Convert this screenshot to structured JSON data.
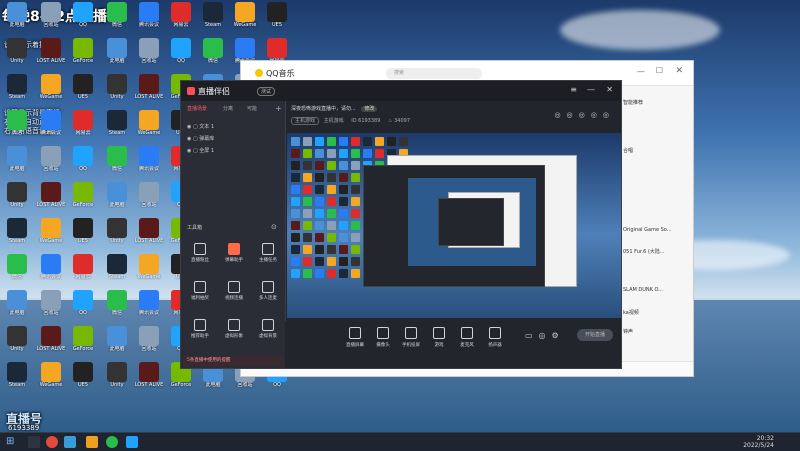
{
  "overlay": {
    "headline": "每晚8-12点直播",
    "left_lines": [
      "说明显示着播消息",
      "设置显示背景直播",
      "右上角自动直播",
      "右上角语音设置"
    ],
    "bottom_brand": "直播号",
    "bottom_id": "6193389"
  },
  "desktop_icons": [
    {
      "label": "此电脑",
      "color": "#4a90d9"
    },
    {
      "label": "回收站",
      "color": "#8aa0b8"
    },
    {
      "label": "QQ",
      "color": "#1fa3ff"
    },
    {
      "label": "微信",
      "color": "#2bbd4c"
    },
    {
      "label": "腾讯会议",
      "color": "#2a7cf5"
    },
    {
      "label": "网易云",
      "color": "#e02b2b"
    },
    {
      "label": "Steam",
      "color": "#1b2838"
    },
    {
      "label": "WeGame",
      "color": "#f5a623"
    },
    {
      "label": "UE5",
      "color": "#222"
    },
    {
      "label": "Unity",
      "color": "#333"
    },
    {
      "label": "LOST ALIVE",
      "color": "#5a1a1a"
    },
    {
      "label": "GeForce",
      "color": "#76b900"
    }
  ],
  "taskbar": {
    "time": "20:32",
    "date": "2022/5/24"
  },
  "qq_music": {
    "title": "QQ音乐",
    "search_placeholder": "搜索",
    "right_list": [
      "智能推荐",
      "合唱",
      "Original Game So...",
      "051 Fur.6 (大陆...",
      "SLAM DUNK O...",
      "ka视频",
      "钟声"
    ]
  },
  "live_tool": {
    "title": "直播伴侣",
    "badge": "测试",
    "tabs": [
      "直播场景",
      "分离",
      "可能"
    ],
    "scenes": [
      "文本 1",
      "弹幕库",
      "全屏 1"
    ],
    "tools_label": "工具箱",
    "tools": [
      {
        "label": "直播粉丝",
        "on": false
      },
      {
        "label": "弹幕助手",
        "on": true
      },
      {
        "label": "主播任务",
        "on": false
      },
      {
        "label": "福利抽奖",
        "on": false
      },
      {
        "label": "视频连播",
        "on": false
      },
      {
        "label": "多人连麦",
        "on": false
      },
      {
        "label": "推荐助手",
        "on": false
      },
      {
        "label": "虚拟形象",
        "on": false
      },
      {
        "label": "虚拟背景",
        "on": false
      }
    ],
    "banner": "5条直播中使用的提醒",
    "info_title": "深夜恐怖游戏直播中，请勿...",
    "info_badge": "修改",
    "info_id": "6193389",
    "info_views": "34097",
    "info_tag1": "主机游戏",
    "info_tag2": "主机游戏",
    "bottom_buttons": [
      "直播屏幕",
      "摄像头",
      "手机投屏",
      "游戏",
      "麦克风",
      "扬声器"
    ],
    "start_label": "开始直播"
  }
}
